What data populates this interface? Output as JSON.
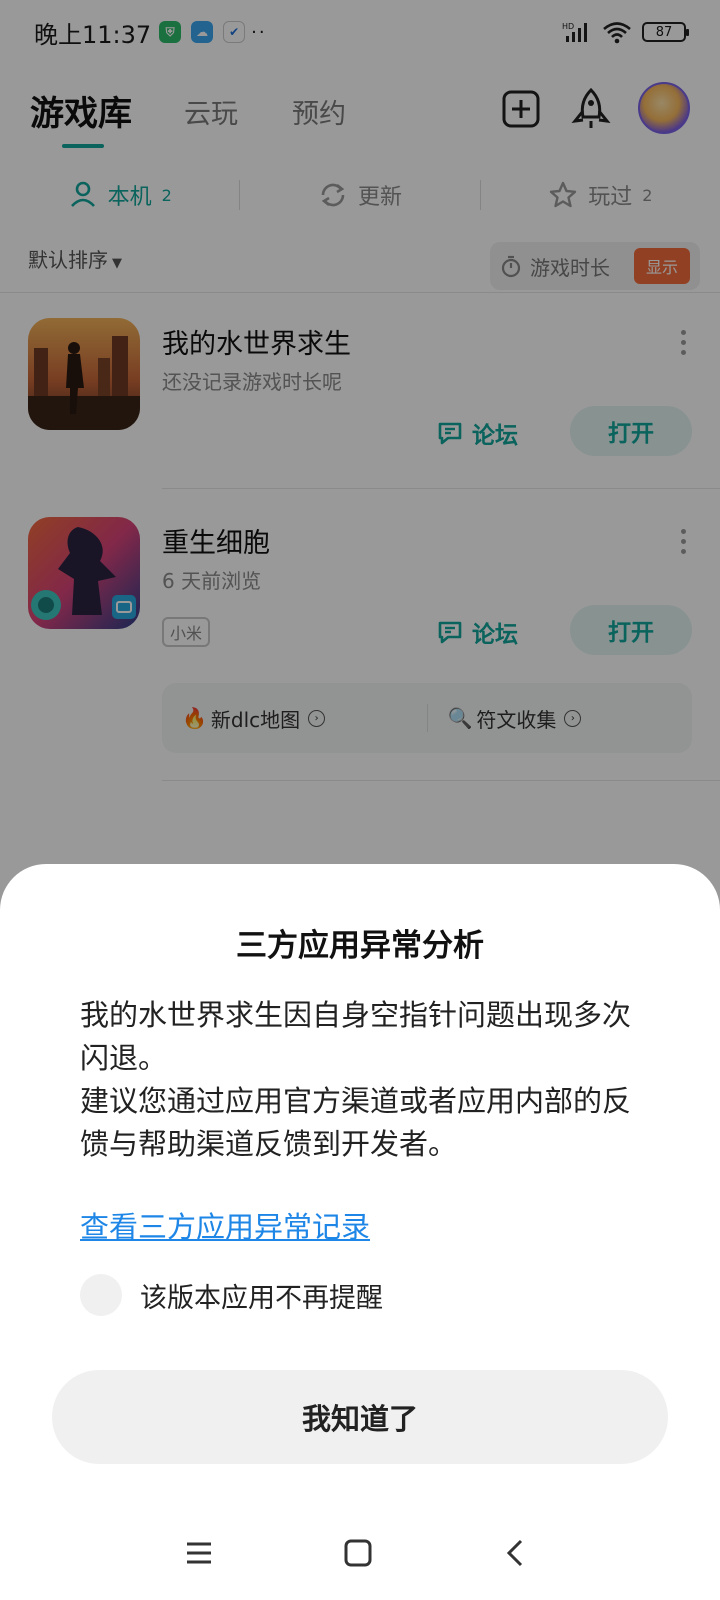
{
  "status_bar": {
    "time": "晚上11:37",
    "dots": "··",
    "battery": "87"
  },
  "header": {
    "tabs": [
      {
        "label": "游戏库",
        "active": true
      },
      {
        "label": "云玩"
      },
      {
        "label": "预约"
      }
    ]
  },
  "filters": [
    {
      "label": "本机",
      "count": "2",
      "icon": "person-icon",
      "active": true
    },
    {
      "label": "更新",
      "count": "",
      "icon": "refresh-icon"
    },
    {
      "label": "玩过",
      "count": "2",
      "icon": "star-icon"
    }
  ],
  "sort": {
    "label": "默认排序",
    "playtime_label": "游戏时长",
    "show_label": "显示"
  },
  "games": [
    {
      "name": "我的水世界求生",
      "subtitle": "还没记录游戏时长呢",
      "forum_label": "论坛",
      "open_label": "打开"
    },
    {
      "name": "重生细胞",
      "subtitle": "6 天前浏览",
      "tag": "小米",
      "forum_label": "论坛",
      "open_label": "打开",
      "links": [
        {
          "emoji": "🔥",
          "label": "新dlc地图"
        },
        {
          "emoji": "🔍",
          "label": "符文收集"
        }
      ]
    }
  ],
  "dialog": {
    "title": "三方应用异常分析",
    "body_line1": "我的水世界求生因自身空指针问题出现多次闪退。",
    "body_line2": "建议您通过应用官方渠道或者应用内部的反馈与帮助渠道反馈到开发者。",
    "link_text": "查看三方应用异常记录",
    "checkbox_label": "该版本应用不再提醒",
    "confirm_label": "我知道了"
  },
  "colors": {
    "accent": "#12a59a",
    "link": "#1e86e6",
    "badge": "#f36b3b"
  }
}
